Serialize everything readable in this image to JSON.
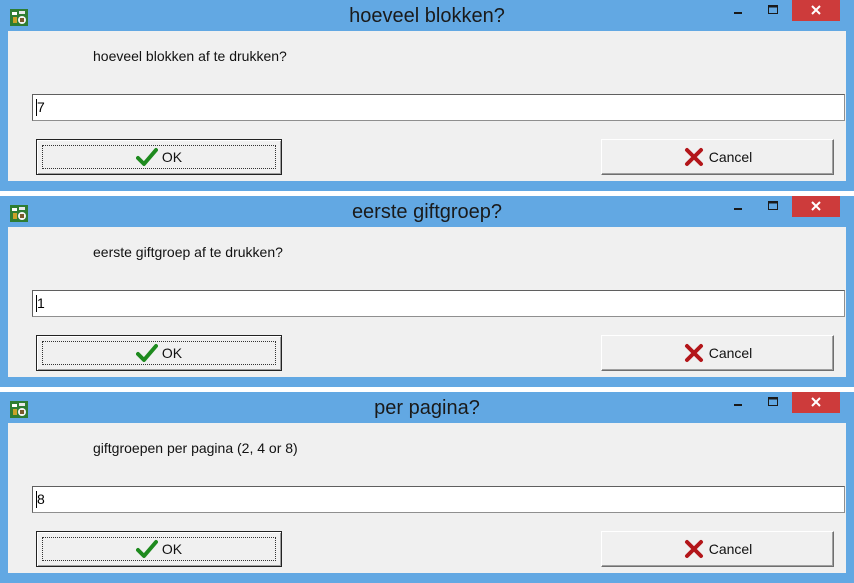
{
  "colors": {
    "frame": "#62a8e3",
    "client": "#f0f0f0",
    "close": "#cd3b3b",
    "ok_icon": "#1e8a1e",
    "cancel_icon": "#b3161a"
  },
  "icons": {
    "app": "app-icon",
    "minimize": "minimize-icon",
    "maximize": "maximize-icon",
    "close": "close-icon",
    "ok": "checkmark-icon",
    "cancel": "x-icon"
  },
  "dialogs": [
    {
      "title": "hoeveel blokken?",
      "prompt": "hoeveel blokken af te drukken?",
      "value": "7",
      "ok_label": "OK",
      "cancel_label": "Cancel"
    },
    {
      "title": "eerste giftgroep?",
      "prompt": "eerste giftgroep af te drukken?",
      "value": "1",
      "ok_label": "OK",
      "cancel_label": "Cancel"
    },
    {
      "title": "per pagina?",
      "prompt": "giftgroepen per pagina (2, 4 or 8)",
      "value": "8",
      "ok_label": "OK",
      "cancel_label": "Cancel"
    }
  ]
}
